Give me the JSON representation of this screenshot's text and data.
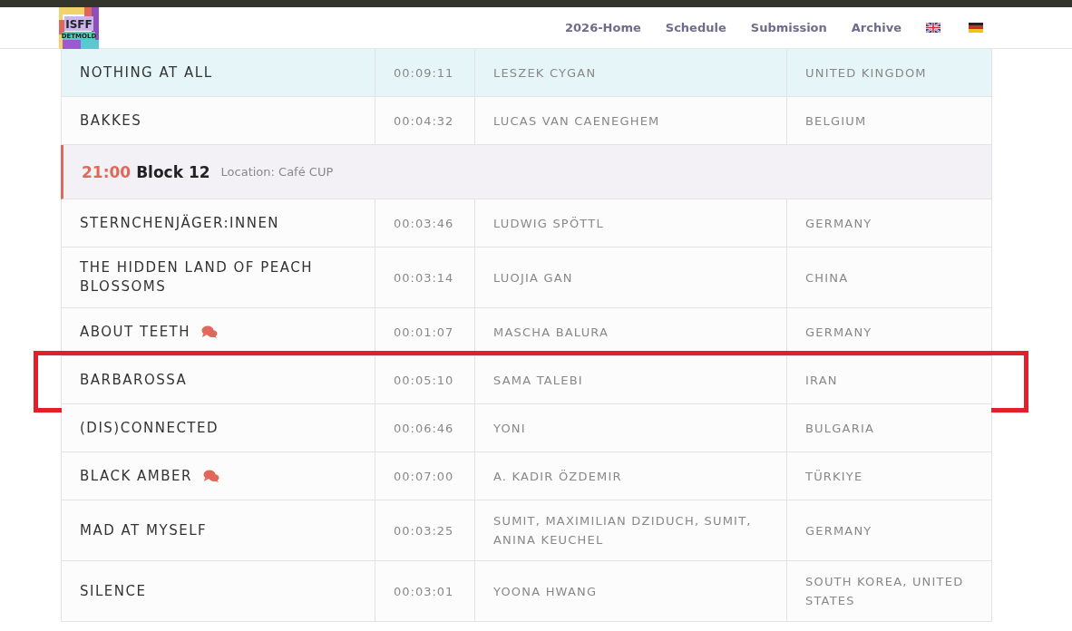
{
  "header": {
    "logo": {
      "line1": "ISFF",
      "line2": "DETMOLD"
    },
    "nav": [
      {
        "label": "2026-Home"
      },
      {
        "label": "Schedule"
      },
      {
        "label": "Submission"
      },
      {
        "label": "Archive"
      }
    ],
    "languages": [
      {
        "kind": "uk"
      },
      {
        "kind": "de"
      }
    ]
  },
  "schedule": [
    {
      "kind": "film",
      "title": "NOTHING AT ALL",
      "duration": "00:09:11",
      "director": "LESZEK CYGAN",
      "country": "UNITED KINGDOM",
      "comments": false,
      "hovered": true,
      "highlighted": false
    },
    {
      "kind": "film",
      "title": "BAKKES",
      "duration": "00:04:32",
      "director": "LUCAS VAN CAENEGHEM",
      "country": "BELGIUM",
      "comments": false,
      "hovered": false,
      "highlighted": false
    },
    {
      "kind": "block",
      "time": "21:00",
      "name": "Block 12",
      "location": "Location: Café CUP"
    },
    {
      "kind": "film",
      "title": "STERNCHENJÄGER:INNEN",
      "duration": "00:03:46",
      "director": "LUDWIG SPÖTTL",
      "country": "GERMANY",
      "comments": false,
      "hovered": false,
      "highlighted": false
    },
    {
      "kind": "film",
      "title": "THE HIDDEN LAND OF PEACH BLOSSOMS",
      "duration": "00:03:14",
      "director": "LUOJIA GAN",
      "country": "CHINA",
      "comments": false,
      "hovered": false,
      "highlighted": false
    },
    {
      "kind": "film",
      "title": "ABOUT TEETH",
      "duration": "00:01:07",
      "director": "MASCHA BALURA",
      "country": "GERMANY",
      "comments": true,
      "hovered": false,
      "highlighted": false
    },
    {
      "kind": "film",
      "title": "BARBAROSSA",
      "duration": "00:05:10",
      "director": "SAMA TALEBI",
      "country": "IRAN",
      "comments": false,
      "hovered": false,
      "highlighted": true
    },
    {
      "kind": "film",
      "title": "(DIS)CONNECTED",
      "duration": "00:06:46",
      "director": "YONI",
      "country": "BULGARIA",
      "comments": false,
      "hovered": false,
      "highlighted": false
    },
    {
      "kind": "film",
      "title": "BLACK AMBER",
      "duration": "00:07:00",
      "director": "A. KADIR ÖZDEMIR",
      "country": "TÜRKIYE",
      "comments": true,
      "hovered": false,
      "highlighted": false
    },
    {
      "kind": "film",
      "title": "MAD AT MYSELF",
      "duration": "00:03:25",
      "director": "SUMIT, MAXIMILIAN DZIDUCH, SUMIT, ANINA KEUCHEL",
      "country": "GERMANY",
      "comments": false,
      "hovered": false,
      "highlighted": false
    },
    {
      "kind": "film",
      "title": "SILENCE",
      "duration": "00:03:01",
      "director": "YOONA HWANG",
      "country": "SOUTH KOREA, UNITED STATES",
      "comments": false,
      "hovered": false,
      "highlighted": false
    }
  ]
}
